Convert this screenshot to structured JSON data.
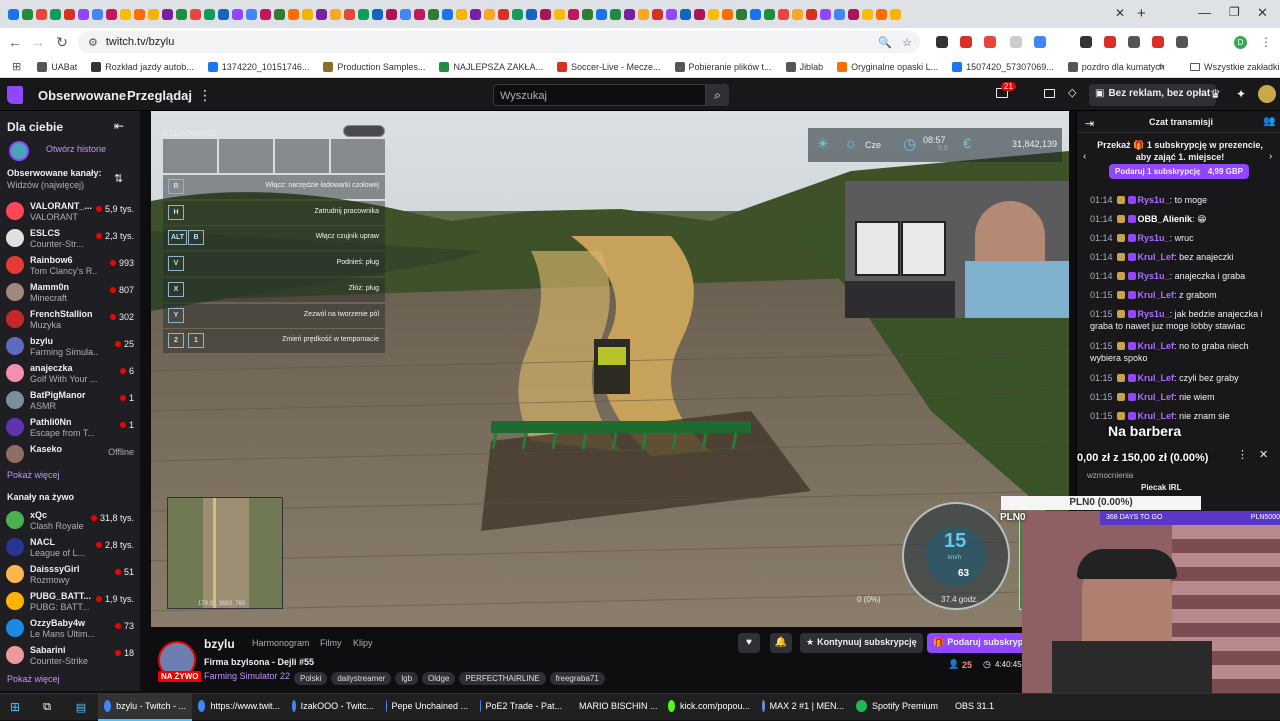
{
  "browser": {
    "active_tab_title": "bzylu - Twitch",
    "url": "twitch.tv/bzylu",
    "tab_favicon_colors": [
      "#1a73e8",
      "#d93025",
      "#fbbc04",
      "#1e8e3e",
      "#9147ff",
      "#ff6d00",
      "#e8453c",
      "#4285f4",
      "#f4b400",
      "#0f9d58",
      "#c2185b",
      "#7b1fa2",
      "#1565c0",
      "#2e7d32",
      "#f9a825",
      "#ad1457"
    ],
    "bookmarks": [
      {
        "label": "UABat",
        "color": "#555"
      },
      {
        "label": "Rozkład jazdy autob...",
        "color": "#333"
      },
      {
        "label": "1374220_10151746...",
        "color": "#1877f2"
      },
      {
        "label": "Production Samples...",
        "color": "#8a6d2b"
      },
      {
        "label": "NAJLEPSZA ZAKŁA...",
        "color": "#1e8e3e"
      },
      {
        "label": "Soccer-Live - Mecze...",
        "color": "#d93025"
      },
      {
        "label": "Pobieranie plików t...",
        "color": "#555"
      },
      {
        "label": "Jiblab",
        "color": "#555"
      },
      {
        "label": "Oryginalne opaski L...",
        "color": "#ff6d00"
      },
      {
        "label": "1507420_57307069...",
        "color": "#1877f2"
      },
      {
        "label": "pozdro dla kumatych",
        "color": "#555"
      }
    ],
    "all_bookmarks": "Wszystkie zakładki"
  },
  "twitch_nav": {
    "following": "Obserwowane",
    "browse": "Przeglądaj",
    "search_placeholder": "Wyszukaj",
    "notif_count": "21",
    "no_ads": "Bez reklam, bez opłat"
  },
  "sidebar": {
    "for_you": "Dla ciebie",
    "open_history": "Otwórz historie",
    "followed_title": "Obserwowane kanały:",
    "followed_sort": "Widzów (najwięcej)",
    "followed": [
      {
        "name": "VALORANT_...",
        "game": "VALORANT",
        "viewers": "5,9 tys.",
        "color": "#ff4655"
      },
      {
        "name": "ESLCS",
        "game": "Counter-Str...",
        "viewers": "2,3 tys.",
        "color": "#e0e0e0"
      },
      {
        "name": "Rainbow6",
        "game": "Tom Clancy's R...",
        "viewers": "993",
        "color": "#e53935"
      },
      {
        "name": "Mamm0n",
        "game": "Minecraft",
        "viewers": "807",
        "color": "#a1887f"
      },
      {
        "name": "FrenchStallion",
        "game": "Muzyka",
        "viewers": "302",
        "color": "#c62828"
      },
      {
        "name": "bzylu",
        "game": "Farming Simula...",
        "viewers": "25",
        "color": "#5c6bc0"
      },
      {
        "name": "anajeczka",
        "game": "Golf With Your ...",
        "viewers": "6",
        "color": "#f48fb1"
      },
      {
        "name": "BatPigManor",
        "game": "ASMR",
        "viewers": "1",
        "color": "#78909c"
      },
      {
        "name": "Pathli0Nn",
        "game": "Escape from T...",
        "viewers": "1",
        "color": "#5e35b1"
      },
      {
        "name": "Kaseko",
        "game": "",
        "viewers": "Offline",
        "color": "#8d6e63"
      }
    ],
    "show_more": "Pokaż więcej",
    "live_title": "Kanały na żywo",
    "live": [
      {
        "name": "xQc",
        "game": "Clash Royale",
        "viewers": "31,8 tys.",
        "color": "#4caf50"
      },
      {
        "name": "NACL",
        "game": "League of L...",
        "viewers": "2,8 tys.",
        "color": "#283593"
      },
      {
        "name": "DaisssyGirl",
        "game": "Rozmowy",
        "viewers": "51",
        "color": "#ffb74d"
      },
      {
        "name": "PUBG_BATT...",
        "game": "PUBG: BATT...",
        "viewers": "1,9 tys.",
        "color": "#ffb300"
      },
      {
        "name": "OzzyBaby4w",
        "game": "Le Mans Ultim...",
        "viewers": "73",
        "color": "#1e88e5"
      },
      {
        "name": "Sabarini",
        "game": "Counter-Strike",
        "viewers": "18",
        "color": "#ef9a9a"
      }
    ],
    "show_more_2": "Pokaż więcej"
  },
  "game_hud": {
    "panel_title": "STEROWANIE",
    "controls": [
      {
        "keys": [
          "B"
        ],
        "label": "Włącz: narzędzie ładowarki czołowej"
      },
      {
        "keys": [
          "H"
        ],
        "label": "Zatrudnij pracownika"
      },
      {
        "keys": [
          "ALT",
          "B"
        ],
        "label": "Włącz czujnik upraw"
      },
      {
        "keys": [
          "V"
        ],
        "label": "Podnieś: pług"
      },
      {
        "keys": [
          "X"
        ],
        "label": "Złóż: pług"
      },
      {
        "keys": [
          "Y"
        ],
        "label": "Zezwól na tworzenie pól"
      },
      {
        "keys": [
          "2",
          "1"
        ],
        "label": "Zmień prędkość w tempomacie"
      }
    ],
    "day": "Cze",
    "time": "08:57",
    "time_scale": "0.5",
    "money": "31,842,139",
    "speed": "15",
    "speed_unit": "km/h",
    "cruise": "63",
    "fuel_pct": "0 (0%)",
    "hours": "37.4 godz.",
    "map_coords": "178.3°, 3683, 765"
  },
  "overlays": {
    "donation_title": "Na barbera",
    "donation_amount": "0,00 zł z 150,00 zł (0.00%)",
    "boost_label": "wzmocnienia",
    "pln_bar": "PLN0 (0.00%)",
    "pln_side": "PLN0",
    "piecak": "Piecak IRL",
    "days_to_go": "368 DAYS TO GO",
    "pln5000": "PLN5000"
  },
  "stream_info": {
    "channel": "bzylu",
    "tabs": [
      "Harmonogram",
      "Filmy",
      "Klipy"
    ],
    "title": "Firma bzylsona - Dejli #55",
    "game": "Farming Simulator 22",
    "tags": [
      "Polski",
      "dailystreamer",
      "lgb",
      "Oldge",
      "PERFECTHAIRLINE",
      "freegraba71"
    ],
    "live_badge": "NA ŻYWO",
    "continue_sub": "Kontynuuj subskrypcję",
    "gift_sub": "Podaruj subskrypcję",
    "viewers": "25",
    "uptime": "4:40:45"
  },
  "chat": {
    "header": "Czat transmisji",
    "promo": "Przekaż 🎁 1 subskrypcję w prezencie, aby zająć 1. miejsce!",
    "gift_btn": "Podaruj 1 subskrypcję",
    "gift_price": "4,99 GBP",
    "messages": [
      {
        "time": "01:14",
        "user": "Rys1u_",
        "text": "to moge",
        "u": "u1"
      },
      {
        "time": "01:14",
        "user": "OBB_Alienik",
        "text": "😁",
        "u": "u2"
      },
      {
        "time": "01:14",
        "user": "Rys1u_",
        "text": "wruc",
        "u": "u1"
      },
      {
        "time": "01:14",
        "user": "Krul_Lef",
        "text": "bez anajeczki",
        "u": "u1"
      },
      {
        "time": "01:14",
        "user": "Rys1u_",
        "text": "anajeczka i graba",
        "u": "u1"
      },
      {
        "time": "01:15",
        "user": "Krul_Lef",
        "text": "z grabom",
        "u": "u1"
      },
      {
        "time": "01:15",
        "user": "Rys1u_",
        "text": "jak bedzie anajeczka i graba to nawet juz moge lobby stawiac",
        "u": "u1"
      },
      {
        "time": "01:15",
        "user": "Krul_Lef",
        "text": "no to graba niech wybiera spoko",
        "u": "u1"
      },
      {
        "time": "01:15",
        "user": "Krul_Lef",
        "text": "czyli bez graby",
        "u": "u1"
      },
      {
        "time": "01:15",
        "user": "Krul_Lef",
        "text": "nie wiem",
        "u": "u1"
      },
      {
        "time": "01:15",
        "user": "Krul_Lef",
        "text": "nie znam sie",
        "u": "u1"
      }
    ]
  },
  "taskbar": [
    {
      "label": "bzylu - Twitch - ...",
      "color": "#4285f4"
    },
    {
      "label": "https://www.twit...",
      "color": "#4285f4"
    },
    {
      "label": "IzakOOO - Twitc...",
      "color": "#4285f4"
    },
    {
      "label": "Pepe Unchained ...",
      "color": "#4285f4"
    },
    {
      "label": "PoE2 Trade - Pat...",
      "color": "#4285f4"
    },
    {
      "label": "MARIO BISCHIN ...",
      "color": "#4285f4"
    },
    {
      "label": "kick.com/popou...",
      "color": "#53fc18"
    },
    {
      "label": "MAX 2 #1 | MEN...",
      "color": "#7289da"
    },
    {
      "label": "Spotify Premium",
      "color": "#1db954"
    },
    {
      "label": "OBS 31.1",
      "color": "#444"
    }
  ]
}
